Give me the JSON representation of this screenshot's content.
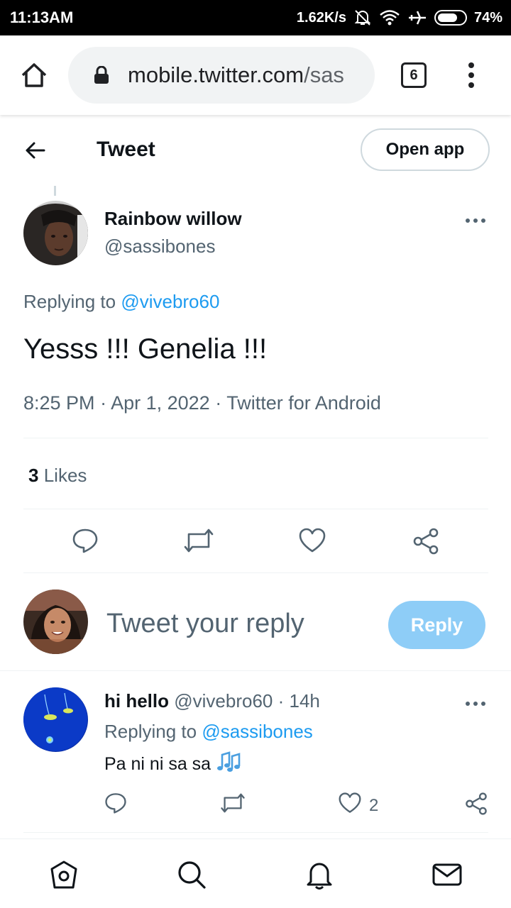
{
  "status_bar": {
    "time": "11:13AM",
    "net_speed": "1.62K/s",
    "battery": "74%",
    "battery_level": 0.74
  },
  "browser": {
    "url_host": "mobile.twitter.com",
    "url_path": "/sas",
    "tab_count": "6"
  },
  "header": {
    "title": "Tweet",
    "open_app_label": "Open app"
  },
  "tweet": {
    "author_name": "Rainbow willow",
    "author_handle": "@sassibones",
    "replying_prefix": "Replying to",
    "replying_to": "@vivebro60",
    "text": "Yesss !!! Genelia !!!",
    "time": "8:25 PM",
    "date": "Apr 1, 2022",
    "source": "Twitter for Android",
    "separator": "·",
    "likes_count": "3",
    "likes_label": "Likes"
  },
  "composer": {
    "placeholder": "Tweet your reply",
    "reply_label": "Reply"
  },
  "reply": {
    "author_name": "hi hello",
    "author_handle": "@vivebro60",
    "time_ago": "14h",
    "separator": "·",
    "replying_prefix": "Replying to",
    "replying_to": "@sassibones",
    "text": "Pa ni ni sa sa",
    "like_count": "2"
  },
  "colors": {
    "accent": "#1d9bf0",
    "reply_button_disabled": "#8ecdf7",
    "secondary_text": "#536471"
  },
  "icons": [
    "home-icon",
    "lock-icon",
    "overflow-menu-icon",
    "back-arrow-icon",
    "more-icon",
    "reply-icon",
    "retweet-icon",
    "like-icon",
    "share-icon",
    "music-notes-icon",
    "search-icon",
    "notifications-icon",
    "messages-icon"
  ]
}
